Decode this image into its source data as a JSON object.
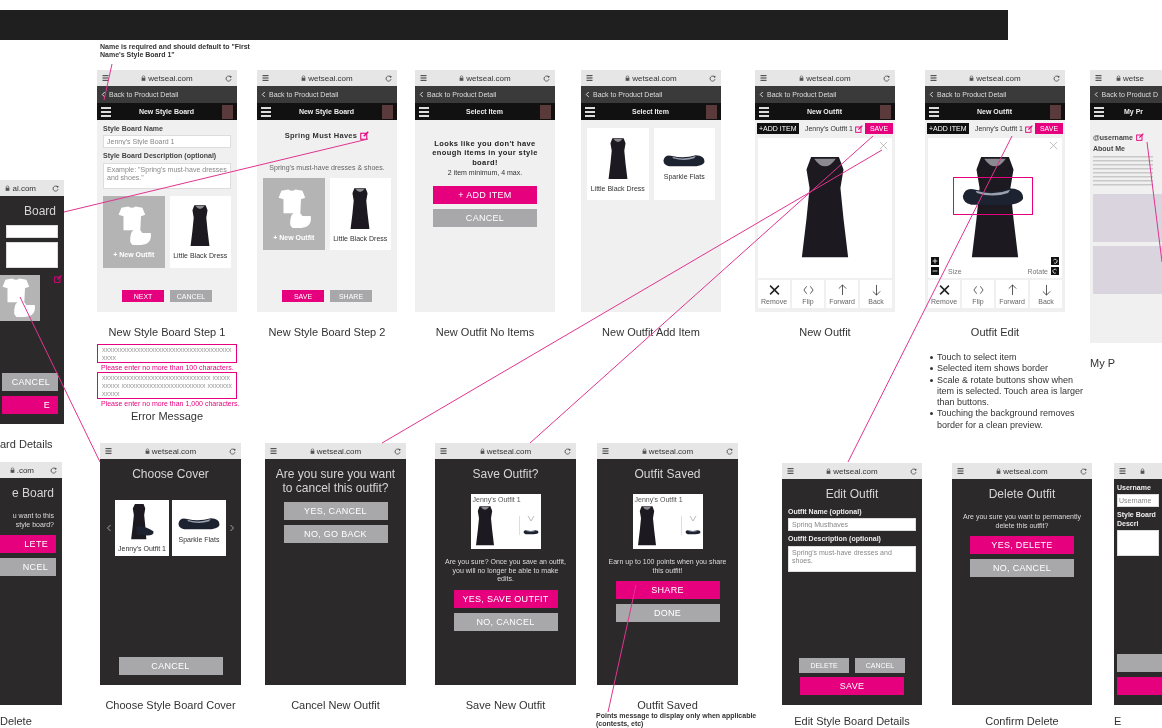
{
  "annotations": [
    {
      "kind": "note",
      "text": "Name is required and should default to \"First Name's Style Board 1\""
    },
    {
      "kind": "footnote",
      "text": "Points message to display only when applicable (contests, etc)"
    }
  ],
  "screens": [
    {
      "kind": "dialog",
      "url": "al.com",
      "title": "Board",
      "caption": "ard Details",
      "blocks": [
        {
          "kind": "field"
        },
        {
          "kind": "textarea"
        },
        {
          "kind": "tiles",
          "items": [
            {
              "kind": "new"
            }
          ],
          "edit": true
        },
        {
          "kind": "footer_stack",
          "items": [
            {
              "label": "CANCEL",
              "kind": "secondary"
            },
            {
              "label": "E",
              "kind": "primary"
            }
          ]
        }
      ]
    },
    {
      "kind": "page",
      "url": "wetseal.com",
      "back": "Back to Product Detail",
      "title": "New Style Board",
      "caption": "New Style Board Step 1",
      "blocks": [
        {
          "kind": "field",
          "label": "Style Board Name",
          "placeholder": "Jenny's Style Board 1"
        },
        {
          "kind": "textarea",
          "label": "Style Board Description (optional)",
          "placeholder": "Example: \"Spring's must-have dresses and shoes.\""
        },
        {
          "kind": "tiles",
          "items": [
            {
              "kind": "new",
              "label": "+ New Outfit"
            },
            {
              "kind": "dress",
              "label": "Little Black Dress"
            }
          ]
        },
        {
          "kind": "footer_row",
          "items": [
            {
              "label": "NEXT",
              "kind": "primary"
            },
            {
              "label": "CANCEL",
              "kind": "secondary"
            }
          ]
        }
      ]
    },
    {
      "kind": "page",
      "url": "wetseal.com",
      "back": "Back to Product Detail",
      "title": "New Style Board",
      "caption": "New Style Board Step 2",
      "blocks": [
        {
          "kind": "heading",
          "text": "Spring Must Haves",
          "sub": "Spring's must-have dresses & shoes."
        },
        {
          "kind": "tiles",
          "items": [
            {
              "kind": "new",
              "label": "+ New Outfit"
            },
            {
              "kind": "dress",
              "label": "Little Black Dress"
            }
          ]
        },
        {
          "kind": "footer_row",
          "items": [
            {
              "label": "SAVE",
              "kind": "primary"
            },
            {
              "label": "SHARE",
              "kind": "secondary"
            }
          ]
        }
      ]
    },
    {
      "kind": "page",
      "url": "wetseal.com",
      "back": "Back to Product Detail",
      "title": "Select Item",
      "caption": "New Outfit No Items",
      "blocks": [
        {
          "kind": "message",
          "text": "Looks like you don't have enough items in your style board!",
          "note": "2 item minimum, 4 max."
        },
        {
          "kind": "button_stack",
          "items": [
            {
              "label": "+ ADD ITEM",
              "kind": "primary"
            },
            {
              "label": "CANCEL",
              "kind": "secondary"
            }
          ]
        }
      ]
    },
    {
      "kind": "page",
      "url": "wetseal.com",
      "back": "Back to Product Detail",
      "title": "Select Item",
      "caption": "New Outfit Add Item",
      "blocks": [
        {
          "kind": "tiles",
          "items": [
            {
              "kind": "dress",
              "label": "Little Black Dress"
            },
            {
              "kind": "shoe",
              "label": "Sparkle Flats"
            }
          ]
        }
      ]
    },
    {
      "kind": "page",
      "url": "wetseal.com",
      "back": "Back to Product Detail",
      "title": "New Outfit",
      "caption": "New Outfit",
      "blocks": [
        {
          "kind": "editor_bar",
          "add": "+ADD ITEM",
          "name": "Jenny's Outfit 1",
          "save": "SAVE"
        },
        {
          "kind": "canvas"
        },
        {
          "kind": "tools",
          "items": [
            {
              "kind": "remove",
              "label": "Remove"
            },
            {
              "kind": "flip",
              "label": "Flip"
            },
            {
              "kind": "forward",
              "label": "Forward"
            },
            {
              "kind": "back",
              "label": "Back"
            }
          ]
        }
      ]
    },
    {
      "kind": "page",
      "url": "wetseal.com",
      "back": "Back to Product Detail",
      "title": "New Outfit",
      "caption": "Outfit Edit",
      "blocks": [
        {
          "kind": "editor_bar",
          "add": "+ADD ITEM",
          "name": "Jenny's Outfit 1",
          "save": "SAVE"
        },
        {
          "kind": "canvas",
          "shoe": {
            "selected": true
          },
          "size": "Size",
          "rotate": "Rotate"
        },
        {
          "kind": "tools",
          "items": [
            {
              "kind": "remove",
              "label": "Remove"
            },
            {
              "kind": "flip",
              "label": "Flip"
            },
            {
              "kind": "forward",
              "label": "Forward"
            },
            {
              "kind": "back",
              "label": "Back"
            }
          ]
        }
      ]
    },
    {
      "kind": "page",
      "url": "wetse",
      "back": "Back to Product D",
      "title": "My Pr",
      "caption": "My P",
      "blocks": [
        {
          "kind": "profile",
          "username": "@username",
          "about": "About Me"
        }
      ]
    },
    {
      "kind": "dialog",
      "url": ".com",
      "title": "e Board",
      "caption": "Delete",
      "blocks": [
        {
          "kind": "text",
          "text": "u want to this style board?"
        },
        {
          "kind": "button_stack",
          "items": [
            {
              "label": "LETE",
              "kind": "primary"
            },
            {
              "label": "NCEL",
              "kind": "secondary"
            }
          ]
        }
      ]
    },
    {
      "kind": "dialog",
      "url": "wetseal.com",
      "title": "Choose Cover",
      "caption": "Choose Style Board Cover",
      "blocks": [
        {
          "kind": "carousel",
          "items": [
            {
              "kind": "outfit",
              "label": "Jenny's Outfit 1"
            },
            {
              "kind": "shoe",
              "label": "Sparkle Flats"
            }
          ]
        },
        {
          "kind": "footer_stack",
          "items": [
            {
              "label": "CANCEL",
              "kind": "secondary"
            }
          ]
        }
      ]
    },
    {
      "kind": "dialog",
      "url": "wetseal.com",
      "title": "Are you sure you want to cancel this outfit?",
      "caption": "Cancel New Outfit",
      "blocks": [
        {
          "kind": "button_stack",
          "items": [
            {
              "label": "YES, CANCEL",
              "kind": "secondary"
            },
            {
              "label": "NO, GO BACK",
              "kind": "secondary"
            }
          ]
        }
      ]
    },
    {
      "kind": "dialog",
      "url": "wetseal.com",
      "title": "Save Outfit?",
      "caption": "Save New Outfit",
      "blocks": [
        {
          "kind": "preview",
          "name": "Jenny's Outfit 1"
        },
        {
          "kind": "text",
          "text": "Are you sure? Once you save an outfit, you will no longer be able to make edits."
        },
        {
          "kind": "button_stack",
          "items": [
            {
              "label": "YES, SAVE OUTFIT",
              "kind": "primary"
            },
            {
              "label": "NO, CANCEL",
              "kind": "secondary"
            }
          ]
        }
      ]
    },
    {
      "kind": "dialog",
      "url": "wetseal.com",
      "title": "Outfit Saved",
      "caption": "Outfit Saved",
      "blocks": [
        {
          "kind": "preview",
          "name": "Jenny's Outfit 1"
        },
        {
          "kind": "text",
          "text": "Earn up to 100 points when you share this outfit!"
        },
        {
          "kind": "button_stack",
          "items": [
            {
              "label": "SHARE",
              "kind": "primary"
            },
            {
              "label": "DONE",
              "kind": "secondary"
            }
          ]
        }
      ]
    },
    {
      "kind": "dialog",
      "url": "wetseal.com",
      "title": "Edit Outfit",
      "caption": "Edit Style Board Details",
      "blocks": [
        {
          "kind": "field",
          "label": "Outfit Name (optional)",
          "placeholder": "Spring Musthaves"
        },
        {
          "kind": "textarea",
          "label": "Outfit Description (optional)",
          "placeholder": "Spring's must-have dresses and shoes."
        },
        {
          "kind": "footer_row",
          "items": [
            {
              "label": "DELETE",
              "kind": "secondary"
            },
            {
              "label": "CANCEL",
              "kind": "secondary"
            }
          ]
        },
        {
          "kind": "button_stack",
          "items": [
            {
              "label": "SAVE",
              "kind": "primary"
            }
          ]
        }
      ]
    },
    {
      "kind": "dialog",
      "url": "wetseal.com",
      "title": "Delete Outfit",
      "caption": "Confirm Delete",
      "blocks": [
        {
          "kind": "text",
          "text": "Are you sure you want to permanently delete this outfit?"
        },
        {
          "kind": "button_stack",
          "items": [
            {
              "label": "YES, DELETE",
              "kind": "primary"
            },
            {
              "label": "NO, CANCEL",
              "kind": "secondary"
            }
          ]
        }
      ]
    },
    {
      "kind": "dialog",
      "caption": "E",
      "blocks": [
        {
          "kind": "field",
          "label": "Username",
          "placeholder": "Username"
        },
        {
          "kind": "textarea",
          "label": "Style Board Descri"
        },
        {
          "kind": "footer_stack",
          "items": [
            {
              "kind": "secondary"
            },
            {
              "kind": "primary"
            }
          ]
        }
      ]
    }
  ],
  "error_example": {
    "caption": "Error Message",
    "fields": [
      {
        "value": "xxxxxxxxxxxxxxxxxxxxxxxxxxxxxxxxxxxxxxxxx",
        "message": "Please enter no more than 100 characters."
      },
      {
        "value": "xxxxxxxxxxxxxxxxxxxxxxxxxxxxxxx xxxxxxxxxx xxxxxxxxxxxxxxxxxxxxxxxx xxxxxxxxxxxx",
        "message": "Please enter no more than 1,000 characters."
      }
    ]
  },
  "notes": [
    "Touch to select item",
    "Selected item shows border",
    "Scale & rotate buttons show when item is selected. Touch area is larger than buttons.",
    "Touching the background removes border for a clean preview."
  ]
}
